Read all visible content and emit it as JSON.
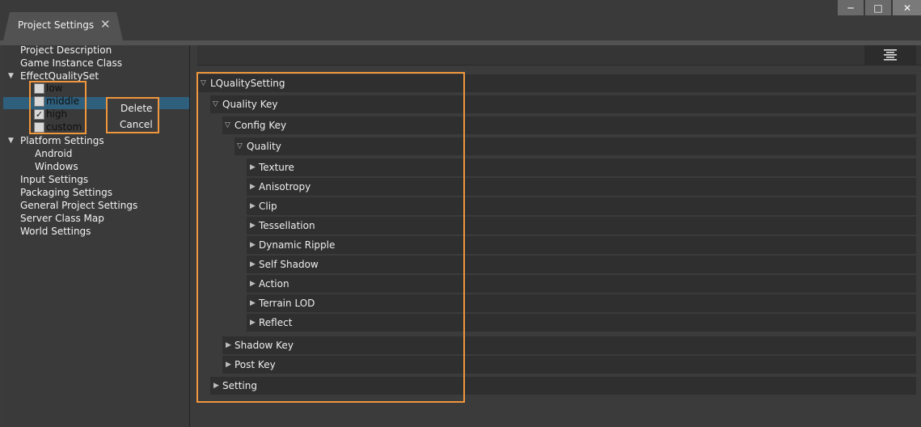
{
  "window": {
    "tab_title": "Project Settings",
    "controls": [
      "minimize-icon",
      "maximize-icon",
      "close-icon"
    ]
  },
  "sidebar": {
    "items": [
      {
        "label": "Project Description"
      },
      {
        "label": "Game Instance Class"
      },
      {
        "label": "EffectQualitySet"
      },
      {
        "label": "Platform Settings"
      },
      {
        "label": "Android"
      },
      {
        "label": "Windows"
      },
      {
        "label": "Input Settings"
      },
      {
        "label": "Packaging Settings"
      },
      {
        "label": "General Project Settings"
      },
      {
        "label": "Server Class Map"
      },
      {
        "label": "World Settings"
      }
    ],
    "quality_options": [
      {
        "label": "low",
        "checked": false
      },
      {
        "label": "middle",
        "checked": false
      },
      {
        "label": "high",
        "checked": true
      },
      {
        "label": "custom",
        "checked": false
      }
    ],
    "selected_option": "middle",
    "context_menu": [
      "Delete",
      "Cancel"
    ]
  },
  "details": {
    "toolbar_icon": "align-center-icon",
    "tree": [
      {
        "label": "LQualitySetting",
        "expanded": true
      },
      {
        "label": "Quality Key",
        "expanded": true
      },
      {
        "label": "Config Key",
        "expanded": true
      },
      {
        "label": "Quality",
        "expanded": true
      },
      {
        "label": "Texture",
        "expanded": false
      },
      {
        "label": "Anisotropy",
        "expanded": false
      },
      {
        "label": "Clip",
        "expanded": false
      },
      {
        "label": "Tessellation",
        "expanded": false
      },
      {
        "label": "Dynamic Ripple",
        "expanded": false
      },
      {
        "label": "Self Shadow",
        "expanded": false
      },
      {
        "label": "Action",
        "expanded": false
      },
      {
        "label": "Terrain LOD",
        "expanded": false
      },
      {
        "label": "Reflect",
        "expanded": false
      },
      {
        "label": "Shadow Key",
        "expanded": false
      },
      {
        "label": "Post Key",
        "expanded": false
      },
      {
        "label": "Setting",
        "expanded": false
      }
    ]
  },
  "colors": {
    "highlight": "#f0963c",
    "selection": "#2e5f7d",
    "panel": "#3b3b3b",
    "row": "#2f2f2f"
  }
}
